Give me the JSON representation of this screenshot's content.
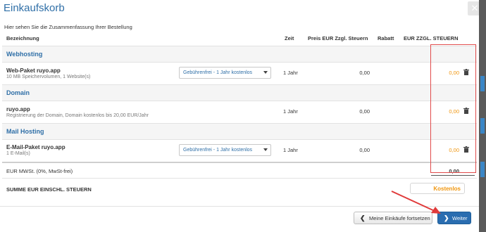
{
  "title": "Einkaufskorb",
  "intro": "Hier sehen Sie die Zusammenfassung Ihrer Bestellung",
  "columns": {
    "bezeichnung": "Bezeichnung",
    "zeit": "Zeit",
    "preis": "Preis EUR Zzgl. Steuern",
    "rabatt": "Rabatt",
    "total": "EUR ZZGL. STEUERN"
  },
  "sections": [
    {
      "label": "Webhosting",
      "item": {
        "name": "Web-Paket ruyo.app",
        "desc": "10 MB Speichervolumen, 1 Website(s)",
        "option": "Gebührenfrei - 1 Jahr kostenlos",
        "zeit": "1 Jahr",
        "preis": "0,00",
        "total": "0,00"
      }
    },
    {
      "label": "Domain",
      "item": {
        "name": "ruyo.app",
        "desc": "Registrierung der Domain, Domain kostenlos bis 20,00 EUR/Jahr",
        "zeit": "1 Jahr",
        "preis": "0,00",
        "total": "0,00"
      }
    },
    {
      "label": "Mail Hosting",
      "item": {
        "name": "E-Mail-Paket ruyo.app",
        "desc": "1 E-Mail(s)",
        "option": "Gebührenfrei - 1 Jahr kostenlos",
        "zeit": "1 Jahr",
        "preis": "0,00",
        "total": "0,00"
      }
    }
  ],
  "mwst": {
    "label": "EUR MWSt. (0%, MwSt-frei)",
    "value": "0,00"
  },
  "summe": {
    "label": "SUMME EUR EINSCHL. STEUERN",
    "value": "Kostenlos"
  },
  "buttons": {
    "back": "Meine Einkäufe fortsetzen",
    "next": "Weiter"
  },
  "icons": {
    "close": "close-icon",
    "trash": "trash-icon",
    "back": "chevron-left-icon",
    "next": "chevron-right-icon"
  },
  "colors": {
    "accent": "#2f6fa7",
    "orange": "#f0960f",
    "highlight": "#e14b4b",
    "primary_button": "#2a6db0"
  }
}
